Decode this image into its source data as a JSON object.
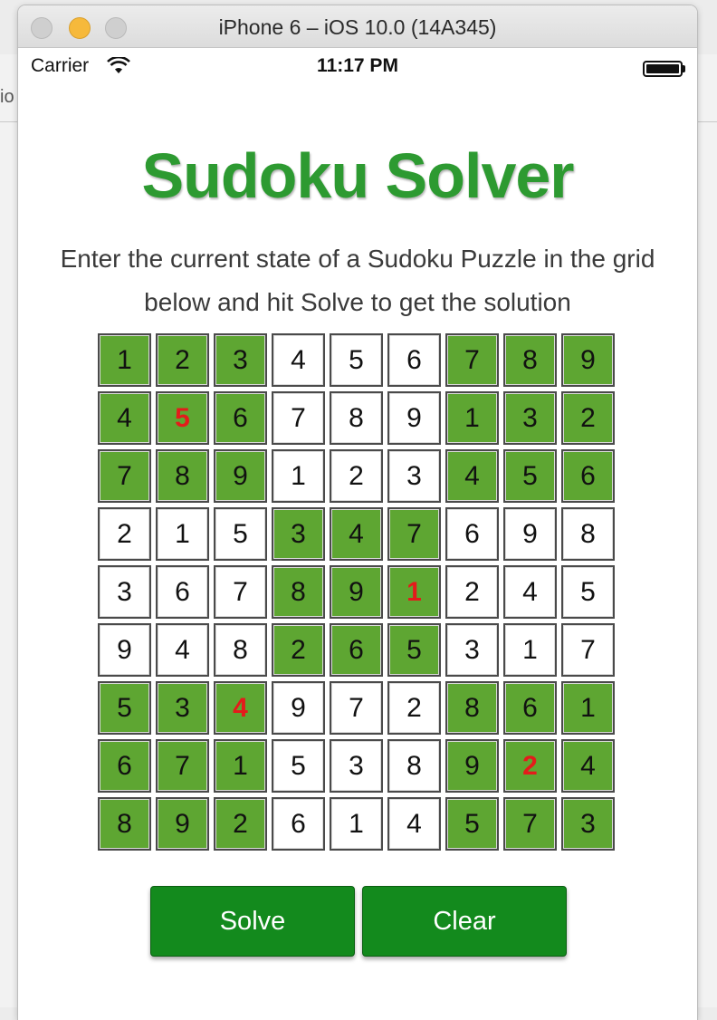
{
  "window": {
    "title": "iPhone 6 – iOS 10.0 (14A345)"
  },
  "background": {
    "partial_text": "io"
  },
  "statusbar": {
    "carrier": "Carrier",
    "time": "11:17 PM"
  },
  "app": {
    "title": "Sudoku Solver",
    "instructions": "Enter the current state of a Sudoku Puzzle in the grid below and hit Solve to get the solution",
    "buttons": {
      "solve": "Solve",
      "clear": "Clear"
    }
  },
  "colors": {
    "title_green": "#2d9a31",
    "shaded_cell": "#5ea632",
    "button_green": "#138a1d",
    "solved_digit_red": "#e41b1b"
  },
  "grid": {
    "rows": [
      [
        "1",
        "2",
        "3",
        "4",
        "5",
        "6",
        "7",
        "8",
        "9"
      ],
      [
        "4",
        "5",
        "6",
        "7",
        "8",
        "9",
        "1",
        "3",
        "2"
      ],
      [
        "7",
        "8",
        "9",
        "1",
        "2",
        "3",
        "4",
        "5",
        "6"
      ],
      [
        "2",
        "1",
        "5",
        "3",
        "4",
        "7",
        "6",
        "9",
        "8"
      ],
      [
        "3",
        "6",
        "7",
        "8",
        "9",
        "1",
        "2",
        "4",
        "5"
      ],
      [
        "9",
        "4",
        "8",
        "2",
        "6",
        "5",
        "3",
        "1",
        "7"
      ],
      [
        "5",
        "3",
        "4",
        "9",
        "7",
        "2",
        "8",
        "6",
        "1"
      ],
      [
        "6",
        "7",
        "1",
        "5",
        "3",
        "8",
        "9",
        "2",
        "4"
      ],
      [
        "8",
        "9",
        "2",
        "6",
        "1",
        "4",
        "5",
        "7",
        "3"
      ]
    ],
    "highlighted_cells": [
      [
        1,
        1
      ],
      [
        4,
        5
      ],
      [
        6,
        2
      ],
      [
        7,
        7
      ]
    ]
  }
}
